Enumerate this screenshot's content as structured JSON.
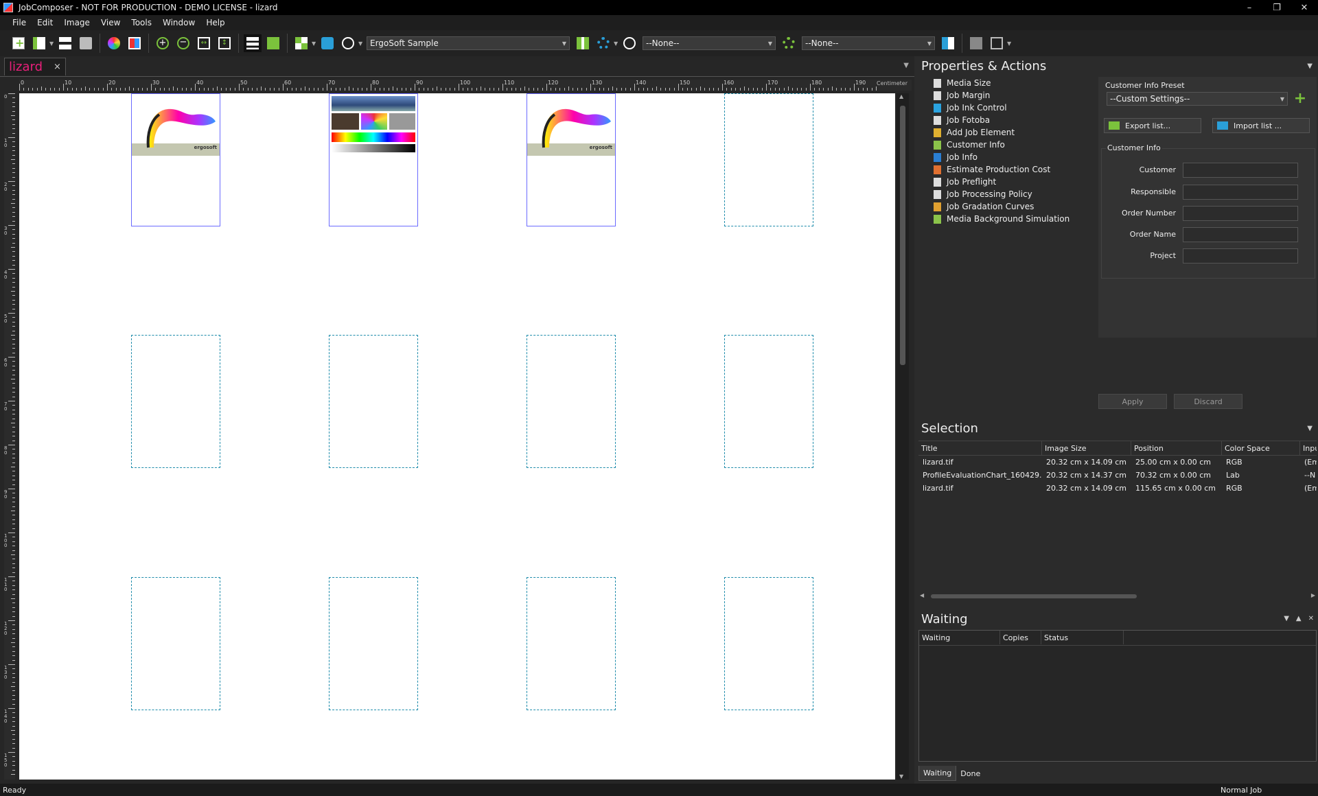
{
  "window": {
    "title": "JobComposer - NOT FOR PRODUCTION - DEMO LICENSE - lizard",
    "controls": [
      "–",
      "❐",
      "✕"
    ]
  },
  "menu": [
    "File",
    "Edit",
    "Image",
    "View",
    "Tools",
    "Window",
    "Help"
  ],
  "toolbar": {
    "profile_combo": "ErgoSoft Sample",
    "combo2": "--None--",
    "combo3": "--None--"
  },
  "document": {
    "tab": "lizard",
    "tab_close": "×",
    "ruler_unit": "Centimeter",
    "ruler_labels": [
      "0",
      "10",
      "20",
      "30",
      "40",
      "50",
      "60",
      "70",
      "80",
      "90",
      "100",
      "110",
      "120",
      "130",
      "140",
      "150",
      "160",
      "170",
      "180",
      "190"
    ],
    "vruler_labels": [
      "0",
      "10",
      "20",
      "30",
      "40",
      "50",
      "60",
      "70",
      "80",
      "90",
      "100",
      "110",
      "120",
      "130",
      "140",
      "150"
    ],
    "tile_brand": "ergosoft"
  },
  "properties": {
    "title": "Properties & Actions",
    "actions": [
      {
        "label": "Media Size",
        "icon": "media-size-icon",
        "color": "#dddddd"
      },
      {
        "label": "Job Margin",
        "icon": "job-margin-icon",
        "color": "#dddddd"
      },
      {
        "label": "Job Ink Control",
        "icon": "ink-drop-icon",
        "color": "#2aa3e0"
      },
      {
        "label": "Job Fotoba",
        "icon": "fotoba-icon",
        "color": "#dddddd"
      },
      {
        "label": "Add Job Element",
        "icon": "add-element-icon",
        "color": "#e0b030"
      },
      {
        "label": "Customer Info",
        "icon": "customer-icon",
        "color": "#8bc34a"
      },
      {
        "label": "Job Info",
        "icon": "info-icon",
        "color": "#2a7fd4"
      },
      {
        "label": "Estimate Production Cost",
        "icon": "cost-icon",
        "color": "#e07030"
      },
      {
        "label": "Job Preflight",
        "icon": "preflight-icon",
        "color": "#dddddd"
      },
      {
        "label": "Job Processing Policy",
        "icon": "policy-icon",
        "color": "#dddddd"
      },
      {
        "label": "Job Gradation Curves",
        "icon": "curves-icon",
        "color": "#e0a030"
      },
      {
        "label": "Media Background Simulation",
        "icon": "background-icon",
        "color": "#8bc34a"
      }
    ],
    "customer_info": {
      "preset_label": "Customer Info Preset",
      "preset_value": "--Custom Settings--",
      "export": "Export list...",
      "import": "Import list ...",
      "group_label": "Customer Info",
      "fields": [
        "Customer",
        "Responsible",
        "Order Number",
        "Order Name",
        "Project"
      ],
      "apply": "Apply",
      "discard": "Discard"
    }
  },
  "selection": {
    "title": "Selection",
    "columns": [
      "Title",
      "Image Size",
      "Position",
      "Color Space",
      "Inpu"
    ],
    "rows": [
      [
        "lizard.tif",
        "20.32 cm x 14.09 cm",
        "25.00 cm x 0.00 cm",
        "RGB",
        "(Em"
      ],
      [
        "ProfileEvaluationChart_160429...",
        "20.32 cm x 14.37 cm",
        "70.32 cm x 0.00 cm",
        "Lab",
        "--N"
      ],
      [
        "lizard.tif",
        "20.32 cm x 14.09 cm",
        "115.65 cm x 0.00 cm",
        "RGB",
        "(Em"
      ]
    ]
  },
  "waiting": {
    "title": "Waiting",
    "columns": [
      "Waiting",
      "Copies",
      "Status"
    ],
    "tabs": [
      "Waiting",
      "Done"
    ]
  },
  "status": {
    "left": "Ready",
    "right": "Normal Job"
  },
  "colors": {
    "accent_tab": "#e81f7a",
    "guide": "#1e8cab",
    "selected": "#6a6aff",
    "add_green": "#7bc23c"
  }
}
